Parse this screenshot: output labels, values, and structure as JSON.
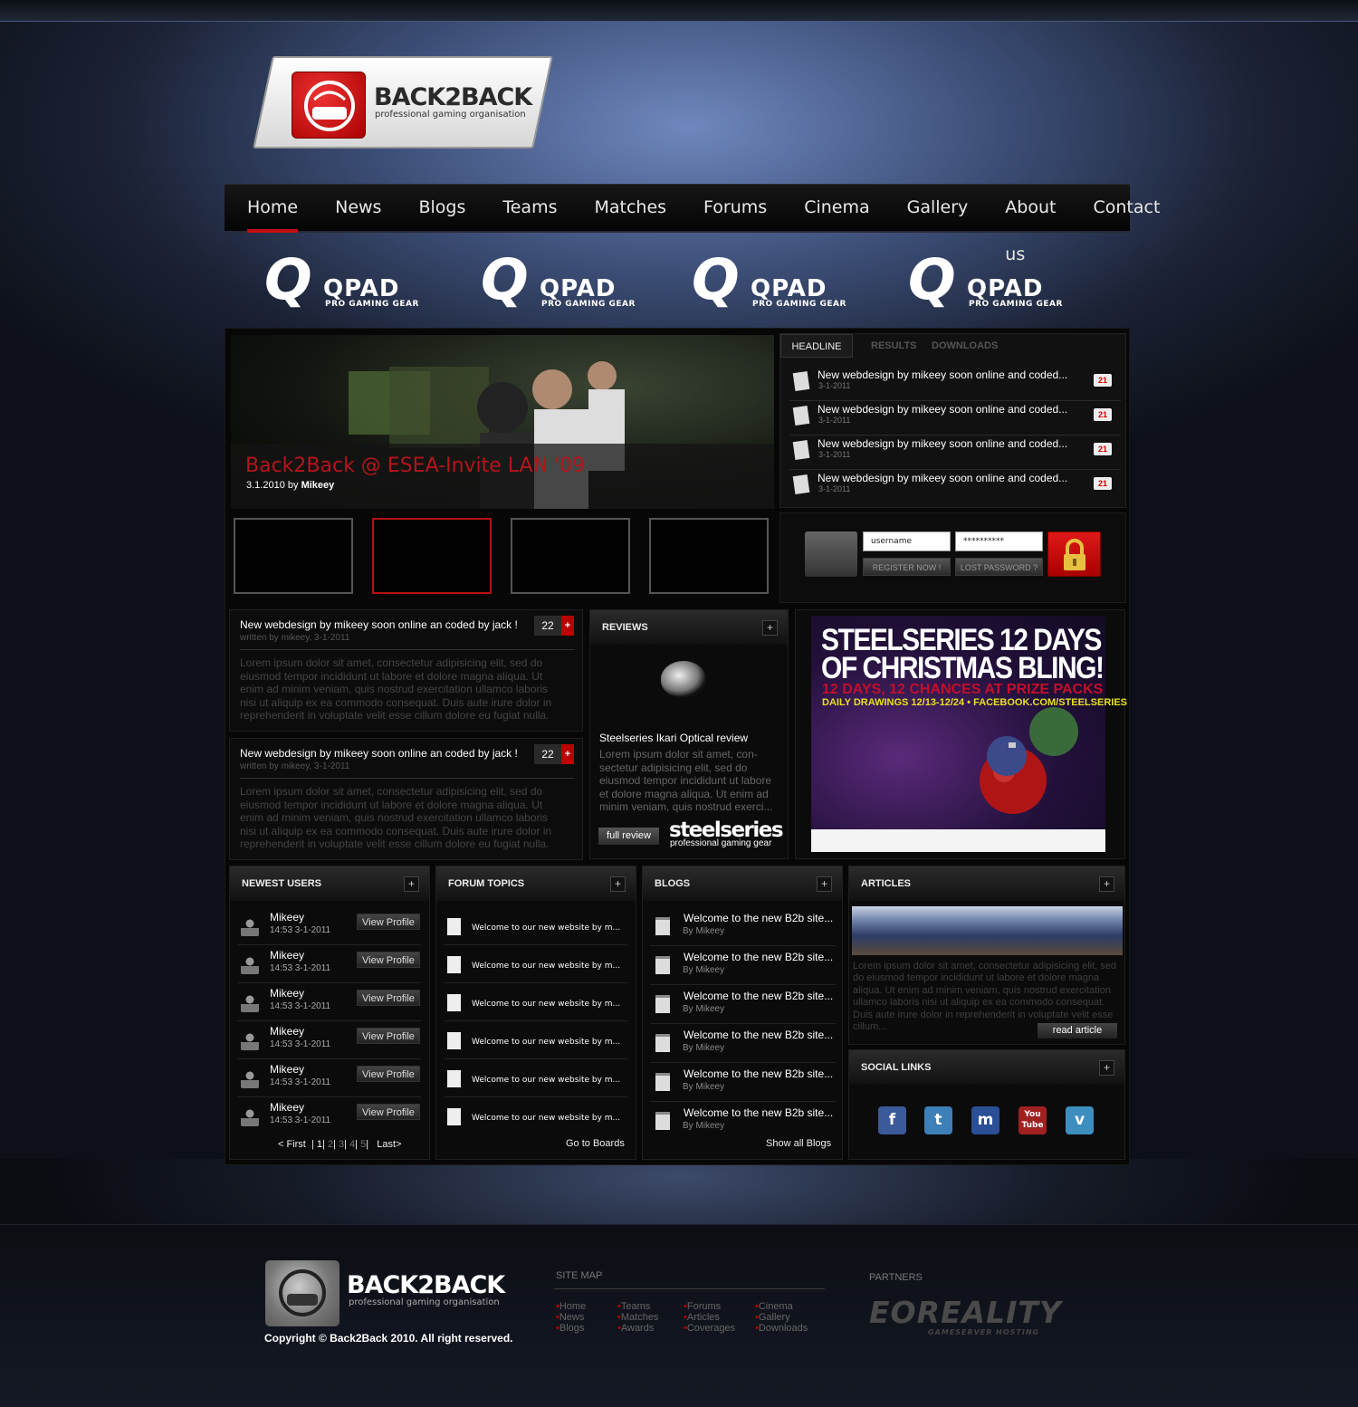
{
  "brand": {
    "name": "BACK2BACK",
    "tagline": "professional gaming organisation"
  },
  "nav": [
    "Home",
    "News",
    "Blogs",
    "Teams",
    "Matches",
    "Forums",
    "Cinema",
    "Gallery",
    "About us",
    "Contact"
  ],
  "sponsors": [
    {
      "word": "QPAD",
      "sub": "PRO GAMING GEAR"
    },
    {
      "word": "QPAD",
      "sub": "PRO GAMING GEAR"
    },
    {
      "word": "QPAD",
      "sub": "PRO GAMING GEAR"
    },
    {
      "word": "QPAD",
      "sub": "PRO GAMING GEAR"
    }
  ],
  "hero": {
    "title": "Back2Back @ ESEA-Invite LAN '09",
    "date": "3.1.2010 by",
    "author": "Mikeey"
  },
  "tabs": {
    "active": "HEADLINE",
    "others": [
      "RESULTS",
      "DOWNLOADS"
    ]
  },
  "headlines": [
    {
      "title": "New webdesign by mikeey soon online and coded...",
      "date": "3-1-2011",
      "count": "21"
    },
    {
      "title": "New webdesign by mikeey soon online and coded...",
      "date": "3-1-2011",
      "count": "21"
    },
    {
      "title": "New webdesign by mikeey soon online and coded...",
      "date": "3-1-2011",
      "count": "21"
    },
    {
      "title": "New webdesign by mikeey soon online and coded...",
      "date": "3-1-2011",
      "count": "21"
    }
  ],
  "login": {
    "username": "username",
    "password": "**********",
    "register": "REGISTER NOW !",
    "lost": "LOST PASSWORD ?"
  },
  "news": [
    {
      "title": "New webdesign by mikeey soon online an coded by jack !",
      "meta": "written by mikeey, 3-1-2011",
      "count": "22",
      "plus": "+",
      "body": "Lorem ipsum dolor sit amet, consectetur adipisicing elit, sed do eiusmod tempor incididunt ut labore et dolore magna aliqua. Ut enim ad minim veniam, quis nostrud exercitation ullamco laboris nisi ut aliquip ex ea commodo consequat. Duis aute irure dolor in reprehenderit in voluptate velit esse cillum dolore eu fugiat nulla."
    },
    {
      "title": "New webdesign by mikeey soon online an coded by jack !",
      "meta": "written by mikeey, 3-1-2011",
      "count": "22",
      "plus": "+",
      "body": "Lorem ipsum dolor sit amet, consectetur adipisicing elit, sed do eiusmod tempor incididunt ut labore et dolore magna aliqua. Ut enim ad minim veniam, quis nostrud exercitation ullamco laboris nisi ut aliquip ex ea commodo consequat. Duis aute irure dolor in reprehenderit in voluptate velit esse cillum dolore eu fugiat nulla."
    }
  ],
  "reviews": {
    "header": "REVIEWS",
    "plus": "+",
    "title": "Steelseries Ikari Optical review",
    "body": "Lorem ipsum dolor sit amet, con-sectetur adipisicing elit, sed do eiusmod tempor incididunt ut labore et dolore magna aliqua. Ut enim ad minim veniam, quis nostrud exerci...",
    "button": "full review",
    "logo": "steelseries",
    "logo_sub": "professional gaming gear"
  },
  "ad": {
    "line1": "STEELSERIES 12 DAYS",
    "line2": "OF CHRISTMAS BLING!",
    "line3": "12 DAYS, 12 CHANCES AT PRIZE PACKS",
    "line4": "DAILY DRAWINGS 12/13-12/24 • FACEBOOK.COM/STEELSERIES"
  },
  "users": {
    "header": "NEWEST USERS",
    "plus": "+",
    "rows": [
      {
        "name": "Mikeey",
        "date": "14:53  3-1-2011",
        "btn": "View Profile"
      },
      {
        "name": "Mikeey",
        "date": "14:53  3-1-2011",
        "btn": "View Profile"
      },
      {
        "name": "Mikeey",
        "date": "14:53  3-1-2011",
        "btn": "View Profile"
      },
      {
        "name": "Mikeey",
        "date": "14:53  3-1-2011",
        "btn": "View Profile"
      },
      {
        "name": "Mikeey",
        "date": "14:53  3-1-2011",
        "btn": "View Profile"
      },
      {
        "name": "Mikeey",
        "date": "14:53  3-1-2011",
        "btn": "View Profile"
      }
    ],
    "pager": {
      "first": "< First",
      "pages": [
        "1",
        "2",
        "3",
        "4",
        "5"
      ],
      "last": "Last>"
    }
  },
  "forum": {
    "header": "FORUM TOPICS",
    "plus": "+",
    "rows": [
      "Welcome to our new website by m...",
      "Welcome to our new website by m...",
      "Welcome to our new website by m...",
      "Welcome to our new website by m...",
      "Welcome to our new website by m...",
      "Welcome to our new website by m..."
    ],
    "link": "Go to Boards"
  },
  "blogs": {
    "header": "BLOGS",
    "plus": "+",
    "rows": [
      {
        "title": "Welcome to the new B2b site...",
        "by": "By Mikeey"
      },
      {
        "title": "Welcome to the new B2b site...",
        "by": "By Mikeey"
      },
      {
        "title": "Welcome to the new B2b site...",
        "by": "By Mikeey"
      },
      {
        "title": "Welcome to the new B2b site...",
        "by": "By Mikeey"
      },
      {
        "title": "Welcome to the new B2b site...",
        "by": "By Mikeey"
      },
      {
        "title": "Welcome to the new B2b site...",
        "by": "By Mikeey"
      }
    ],
    "link": "Show all Blogs"
  },
  "articles": {
    "header": "ARTICLES",
    "plus": "+",
    "body": "Lorem ipsum dolor sit amet, consectetur adipisicing elit, sed do eiusmod tempor incididunt ut labore et dolore magna aliqua. Ut enim ad minim veniam, quis nostrud exercitation ullamco laboris nisi ut aliquip ex ea commodo consequat. Duis aute irure dolor in reprehenderit in voluptate velit esse cillum...",
    "button": "read article"
  },
  "social": {
    "header": "SOCIAL LINKS",
    "plus": "+",
    "icons": [
      {
        "name": "facebook-icon",
        "glyph": "f",
        "color": "#3b5a9a"
      },
      {
        "name": "twitter-icon",
        "glyph": "t",
        "color": "#3d7fb8"
      },
      {
        "name": "myspace-icon",
        "glyph": "m",
        "color": "#2b4f96"
      },
      {
        "name": "youtube-icon",
        "glyph": "You Tube",
        "color": "#a02020"
      },
      {
        "name": "vimeo-icon",
        "glyph": "v",
        "color": "#3d8fc0"
      }
    ]
  },
  "footer": {
    "name": "BACK2BACK",
    "tagline": "professional gaming organisation",
    "copyright": "Copyright © Back2Back 2010. All right reserved.",
    "sitemap_title": "SITE MAP",
    "sitemap": [
      [
        "Home",
        "News",
        "Blogs"
      ],
      [
        "Teams",
        "Matches",
        "Awards"
      ],
      [
        "Forums",
        "Articles",
        "Coverages"
      ],
      [
        "Cinema",
        "Gallery",
        "Downloads"
      ]
    ],
    "partners_title": "PARTNERS",
    "partner": "EOREALITY",
    "partner_sub": "GAMESERVER HOSTING"
  }
}
